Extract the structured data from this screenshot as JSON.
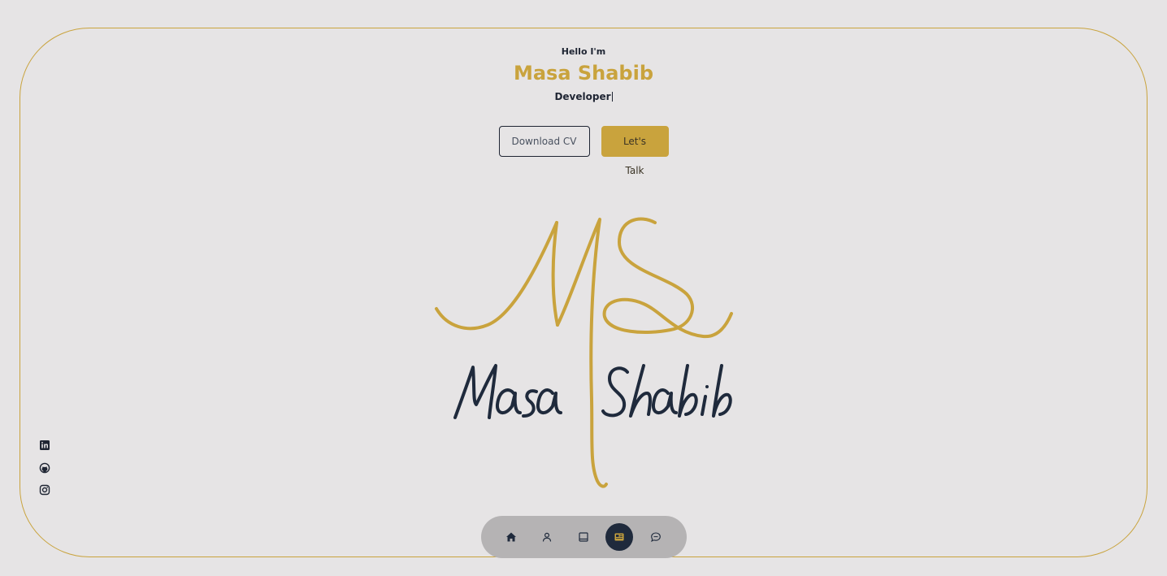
{
  "hero": {
    "greeting": "Hello I'm",
    "name": "Masa Shabib",
    "role": "Developer"
  },
  "cta": {
    "download_cv_label": "Download CV",
    "lets_talk_label": "Let's Talk"
  },
  "logo": {
    "monogram": "MS",
    "signature_text": "Masa Shabib",
    "colors": {
      "gold": "#c9a33d",
      "navy": "#1f2a3c"
    }
  },
  "social": [
    {
      "name": "linkedin",
      "icon": "linkedin-icon"
    },
    {
      "name": "github",
      "icon": "github-icon"
    },
    {
      "name": "instagram",
      "icon": "instagram-icon"
    }
  ],
  "dock": {
    "items": [
      {
        "id": "home",
        "icon": "home-icon"
      },
      {
        "id": "about",
        "icon": "user-icon"
      },
      {
        "id": "experience",
        "icon": "book-icon"
      },
      {
        "id": "portfolio",
        "icon": "news-icon",
        "active": true
      },
      {
        "id": "contact",
        "icon": "message-icon"
      }
    ]
  },
  "colors": {
    "background": "#e6e4e5",
    "accent": "#c9a33d",
    "dark": "#1f2533",
    "dock": "#b5b3b4"
  }
}
